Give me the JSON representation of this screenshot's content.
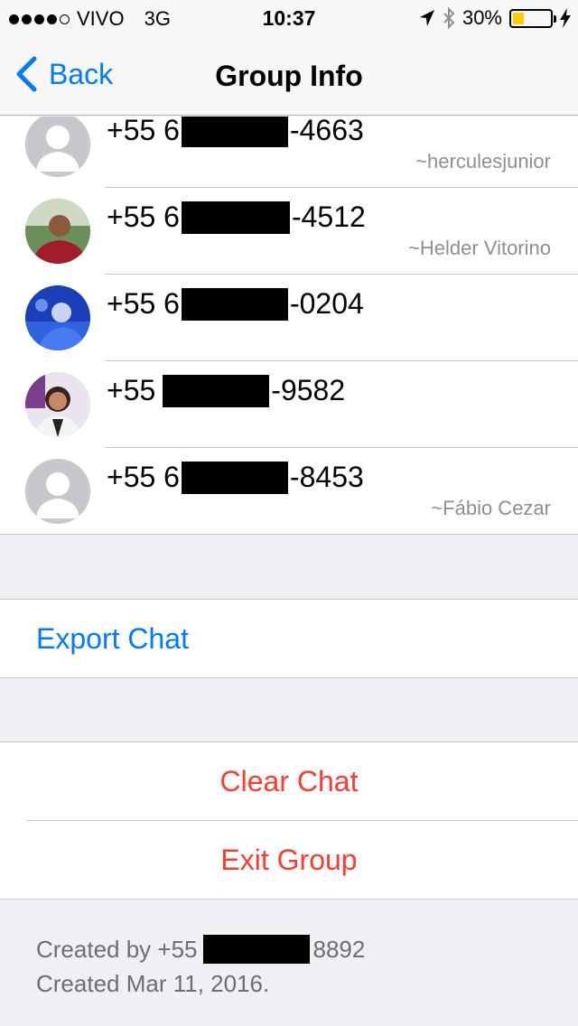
{
  "status_bar": {
    "signal_dots": 4,
    "signal_total": 5,
    "carrier": "VIVO",
    "network": "3G",
    "time": "10:37",
    "battery_text": "30%",
    "battery_level": 0.3,
    "battery_color": "#ffcc00",
    "icons": [
      "location-arrow-icon",
      "bluetooth-icon",
      "charging-bolt-icon"
    ]
  },
  "nav": {
    "back_label": "Back",
    "title": "Group Info"
  },
  "members": [
    {
      "prefix": "+55 6",
      "suffix": "-4663",
      "alias": "~herculesjunior",
      "avatar": "placeholder"
    },
    {
      "prefix": "+55 6",
      "suffix": "-4512",
      "alias": "~Helder Vitorino",
      "avatar": "photo"
    },
    {
      "prefix": "+55 6",
      "suffix": "-0204",
      "alias": "",
      "avatar": "photo"
    },
    {
      "prefix": "+55 ",
      "suffix": "-9582",
      "alias": "",
      "avatar": "photo"
    },
    {
      "prefix": "+55 6",
      "suffix": "-8453",
      "alias": "~Fábio Cezar",
      "avatar": "placeholder"
    }
  ],
  "actions": {
    "export_chat": "Export Chat",
    "clear_chat": "Clear Chat",
    "exit_group": "Exit Group"
  },
  "footer": {
    "created_by_label": "Created by +55",
    "created_by_suffix": "8892",
    "created_date": "Created Mar 11, 2016."
  },
  "colors": {
    "link_blue": "#007aff",
    "destructive_red": "#ff3b30",
    "secondary_gray": "#8e8e93"
  }
}
